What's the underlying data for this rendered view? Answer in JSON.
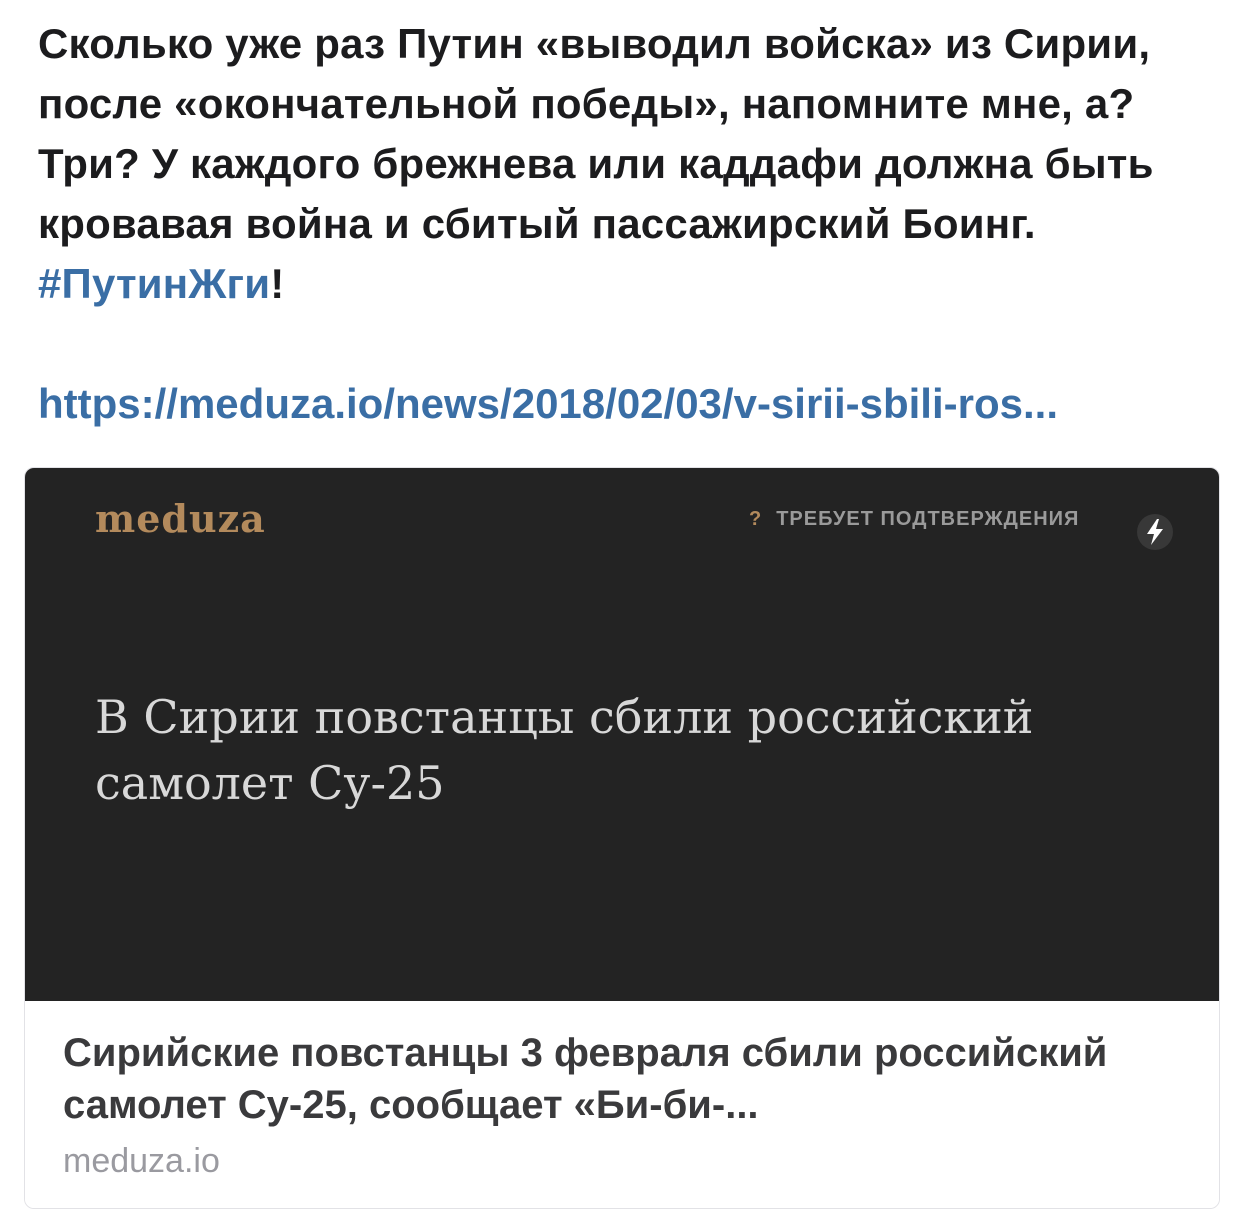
{
  "post": {
    "text_main": "Сколько уже раз Путин «выводил войска» из Сирии, после «окончательной победы», напомните мне, а? Три? У каждого брежнева или каддафи должна быть кровавая война и сбитый пассажирский Боинг. ",
    "hashtag": "#ПутинЖги",
    "text_tail": "!",
    "link": "https://meduza.io/news/2018/02/03/v-sirii-sbili-ros..."
  },
  "card": {
    "brand": "meduza",
    "badge_q": "?",
    "badge_text": "ТРЕБУЕТ ПОДТВЕРЖДЕНИЯ",
    "headline": "В Сирии повстанцы сбили российский самолет Су-25",
    "title": "Сирийские повстанцы 3 февраля сбили российский самолет Су-25, сообщает «Би-би-...",
    "domain": "meduza.io",
    "icon": "lightning-icon"
  },
  "colors": {
    "link": "#3a6ea5",
    "preview_bg": "#232323",
    "brand": "#b38a5c"
  }
}
